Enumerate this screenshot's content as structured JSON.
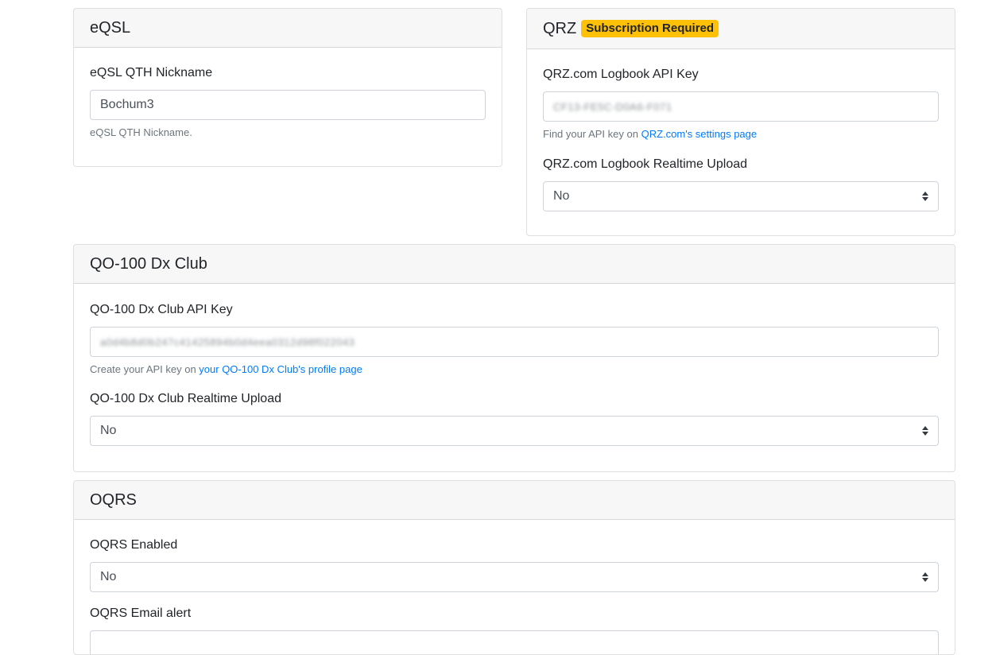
{
  "eqsl": {
    "title": "eQSL",
    "qth_label": "eQSL QTH Nickname",
    "qth_value": "Bochum3",
    "qth_help": "eQSL QTH Nickname."
  },
  "qrz": {
    "title": "QRZ",
    "badge": "Subscription Required",
    "api_key_label": "QRZ.com Logbook API Key",
    "api_key_value": "CF13-FE5C-D0A6-F071",
    "help_prefix": "Find your API key on ",
    "help_link": "QRZ.com's settings page",
    "realtime_label": "QRZ.com Logbook Realtime Upload",
    "realtime_value": "No"
  },
  "qo100": {
    "title": "QO-100 Dx Club",
    "api_key_label": "QO-100 Dx Club API Key",
    "api_key_value": "a0d4b8d0b247c41425894b0d4eea0312d98f022043",
    "help_prefix": "Create your API key on ",
    "help_link": "your QO-100 Dx Club's profile page",
    "realtime_label": "QO-100 Dx Club Realtime Upload",
    "realtime_value": "No"
  },
  "oqrs": {
    "title": "OQRS",
    "enabled_label": "OQRS Enabled",
    "enabled_value": "No",
    "email_label": "OQRS Email alert"
  },
  "colors": {
    "badge": "#ffc107",
    "link": "#007bff",
    "muted": "#6c757d"
  }
}
